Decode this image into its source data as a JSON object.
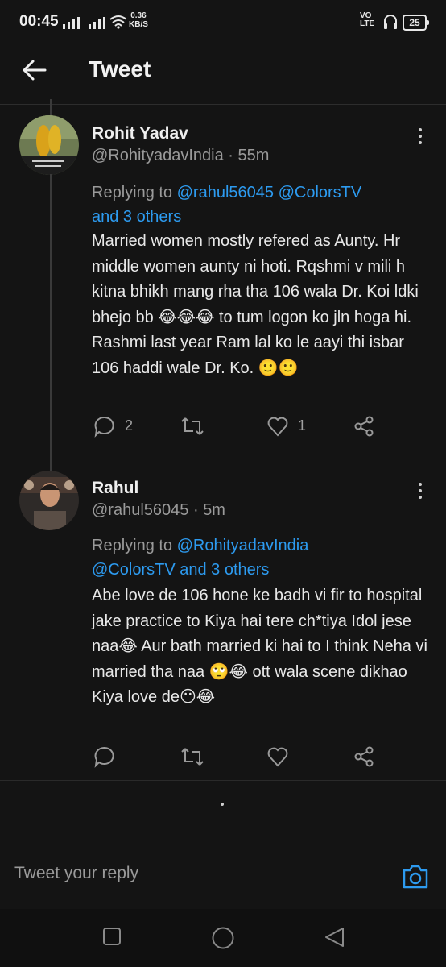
{
  "status_bar": {
    "time": "00:45",
    "net_speed_value": "0.36",
    "net_speed_unit": "KB/S",
    "volte_top": "VO",
    "volte_bottom": "LTE",
    "battery": "25"
  },
  "header": {
    "title": "Tweet"
  },
  "tweets": [
    {
      "name": "Rohit Yadav",
      "handle": "@RohityadavIndia",
      "time": " · 55m",
      "replying_prefix": "Replying to ",
      "replying_link1": "@rahul56045",
      "replying_link2": "@ColorsTV",
      "replying_link3": "and 3 others",
      "text": "Married women mostly refered as Aunty. Hr middle women aunty ni hoti. Rqshmi v mili h kitna bhikh mang rha tha 106 wala Dr. Koi ldki bhejo bb 😂😂😂 to tum logon ko jln hoga hi. Rashmi last year Ram lal ko le aayi thi isbar 106 haddi wale Dr. Ko. 🙂🙂",
      "reply_count": "2",
      "retweet_count": "",
      "like_count": "1"
    },
    {
      "name": "Rahul",
      "handle": "@rahul56045",
      "time": " · 5m",
      "replying_prefix": "Replying to ",
      "replying_link1": "@RohityadavIndia",
      "replying_link2": "@ColorsTV",
      "replying_link3": "and 3 others",
      "text": "Abe love de 106 hone ke badh vi fir to hospital jake practice to Kiya hai tere ch*tiya Idol jese naa😂 Aur bath married ki hai to I think Neha vi married tha naa 🙄😂 ott wala scene dikhao Kiya love de😶😂",
      "reply_count": "",
      "retweet_count": "",
      "like_count": ""
    }
  ],
  "reply_bar": {
    "placeholder": "Tweet your reply"
  },
  "colors": {
    "background": "#141414",
    "accent": "#2d9bf0",
    "secondary_text": "#9a9a9a"
  },
  "icons": [
    "back-arrow-icon",
    "more-options-icon",
    "reply-icon",
    "retweet-icon",
    "like-icon",
    "share-icon",
    "camera-icon",
    "recent-apps-icon",
    "home-icon",
    "back-icon"
  ]
}
